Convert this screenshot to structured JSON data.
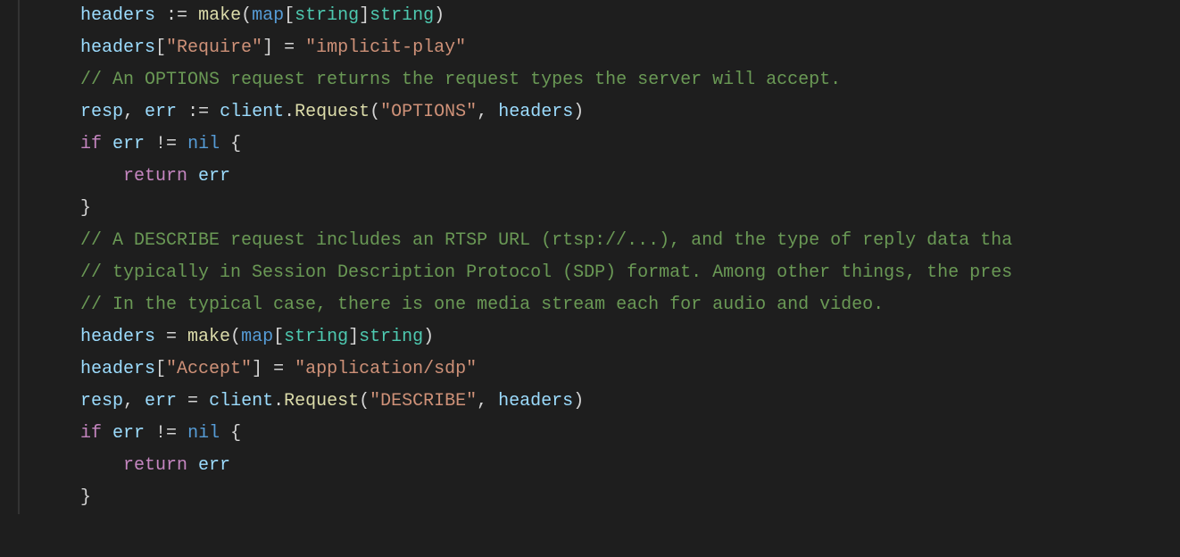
{
  "code": {
    "lines": [
      {
        "indent": 1,
        "tokens": [
          {
            "t": "headers",
            "c": "var"
          },
          {
            "t": " ",
            "c": "punc"
          },
          {
            "t": ":=",
            "c": "punc"
          },
          {
            "t": " ",
            "c": "punc"
          },
          {
            "t": "make",
            "c": "func"
          },
          {
            "t": "(",
            "c": "punc"
          },
          {
            "t": "map",
            "c": "key"
          },
          {
            "t": "[",
            "c": "punc"
          },
          {
            "t": "string",
            "c": "type"
          },
          {
            "t": "]",
            "c": "punc"
          },
          {
            "t": "string",
            "c": "type"
          },
          {
            "t": ")",
            "c": "punc"
          }
        ]
      },
      {
        "indent": 1,
        "tokens": [
          {
            "t": "headers",
            "c": "var"
          },
          {
            "t": "[",
            "c": "punc"
          },
          {
            "t": "\"Require\"",
            "c": "str"
          },
          {
            "t": "]",
            "c": "punc"
          },
          {
            "t": " = ",
            "c": "punc"
          },
          {
            "t": "\"implicit-play\"",
            "c": "str"
          }
        ]
      },
      {
        "indent": 1,
        "tokens": [
          {
            "t": "// An OPTIONS request returns the request types the server will accept.",
            "c": "comment"
          }
        ]
      },
      {
        "indent": 1,
        "tokens": [
          {
            "t": "resp",
            "c": "var"
          },
          {
            "t": ", ",
            "c": "punc"
          },
          {
            "t": "err",
            "c": "var"
          },
          {
            "t": " ",
            "c": "punc"
          },
          {
            "t": ":=",
            "c": "punc"
          },
          {
            "t": " ",
            "c": "punc"
          },
          {
            "t": "client",
            "c": "var"
          },
          {
            "t": ".",
            "c": "punc"
          },
          {
            "t": "Request",
            "c": "func"
          },
          {
            "t": "(",
            "c": "punc"
          },
          {
            "t": "\"OPTIONS\"",
            "c": "str"
          },
          {
            "t": ", ",
            "c": "punc"
          },
          {
            "t": "headers",
            "c": "var"
          },
          {
            "t": ")",
            "c": "punc"
          }
        ]
      },
      {
        "indent": 1,
        "tokens": [
          {
            "t": "if",
            "c": "ctrl"
          },
          {
            "t": " ",
            "c": "punc"
          },
          {
            "t": "err",
            "c": "var"
          },
          {
            "t": " != ",
            "c": "punc"
          },
          {
            "t": "nil",
            "c": "key"
          },
          {
            "t": " {",
            "c": "punc"
          }
        ]
      },
      {
        "indent": 2,
        "tokens": [
          {
            "t": "return",
            "c": "ctrl"
          },
          {
            "t": " ",
            "c": "punc"
          },
          {
            "t": "err",
            "c": "var"
          }
        ]
      },
      {
        "indent": 1,
        "tokens": [
          {
            "t": "}",
            "c": "punc"
          }
        ]
      },
      {
        "indent": 1,
        "tokens": [
          {
            "t": "",
            "c": "punc"
          }
        ]
      },
      {
        "indent": 1,
        "tokens": [
          {
            "t": "// A DESCRIBE request includes an RTSP URL (rtsp://...), and the type of reply data tha",
            "c": "comment"
          }
        ]
      },
      {
        "indent": 1,
        "tokens": [
          {
            "t": "// typically in Session Description Protocol (SDP) format. Among other things, the pres",
            "c": "comment"
          }
        ]
      },
      {
        "indent": 1,
        "tokens": [
          {
            "t": "// In the typical case, there is one media stream each for audio and video.",
            "c": "comment"
          }
        ]
      },
      {
        "indent": 1,
        "tokens": [
          {
            "t": "headers",
            "c": "var"
          },
          {
            "t": " = ",
            "c": "punc"
          },
          {
            "t": "make",
            "c": "func"
          },
          {
            "t": "(",
            "c": "punc"
          },
          {
            "t": "map",
            "c": "key"
          },
          {
            "t": "[",
            "c": "punc"
          },
          {
            "t": "string",
            "c": "type"
          },
          {
            "t": "]",
            "c": "punc"
          },
          {
            "t": "string",
            "c": "type"
          },
          {
            "t": ")",
            "c": "punc"
          }
        ]
      },
      {
        "indent": 1,
        "tokens": [
          {
            "t": "headers",
            "c": "var"
          },
          {
            "t": "[",
            "c": "punc"
          },
          {
            "t": "\"Accept\"",
            "c": "str"
          },
          {
            "t": "]",
            "c": "punc"
          },
          {
            "t": " = ",
            "c": "punc"
          },
          {
            "t": "\"application/sdp\"",
            "c": "str"
          }
        ]
      },
      {
        "indent": 1,
        "tokens": [
          {
            "t": "resp",
            "c": "var"
          },
          {
            "t": ", ",
            "c": "punc"
          },
          {
            "t": "err",
            "c": "var"
          },
          {
            "t": " = ",
            "c": "punc"
          },
          {
            "t": "client",
            "c": "var"
          },
          {
            "t": ".",
            "c": "punc"
          },
          {
            "t": "Request",
            "c": "func"
          },
          {
            "t": "(",
            "c": "punc"
          },
          {
            "t": "\"DESCRIBE\"",
            "c": "str"
          },
          {
            "t": ", ",
            "c": "punc"
          },
          {
            "t": "headers",
            "c": "var"
          },
          {
            "t": ")",
            "c": "punc"
          }
        ]
      },
      {
        "indent": 1,
        "tokens": [
          {
            "t": "if",
            "c": "ctrl"
          },
          {
            "t": " ",
            "c": "punc"
          },
          {
            "t": "err",
            "c": "var"
          },
          {
            "t": " != ",
            "c": "punc"
          },
          {
            "t": "nil",
            "c": "key"
          },
          {
            "t": " {",
            "c": "punc"
          }
        ]
      },
      {
        "indent": 2,
        "tokens": [
          {
            "t": "return",
            "c": "ctrl"
          },
          {
            "t": " ",
            "c": "punc"
          },
          {
            "t": "err",
            "c": "var"
          }
        ]
      },
      {
        "indent": 1,
        "tokens": [
          {
            "t": "}",
            "c": "punc"
          }
        ]
      }
    ]
  }
}
